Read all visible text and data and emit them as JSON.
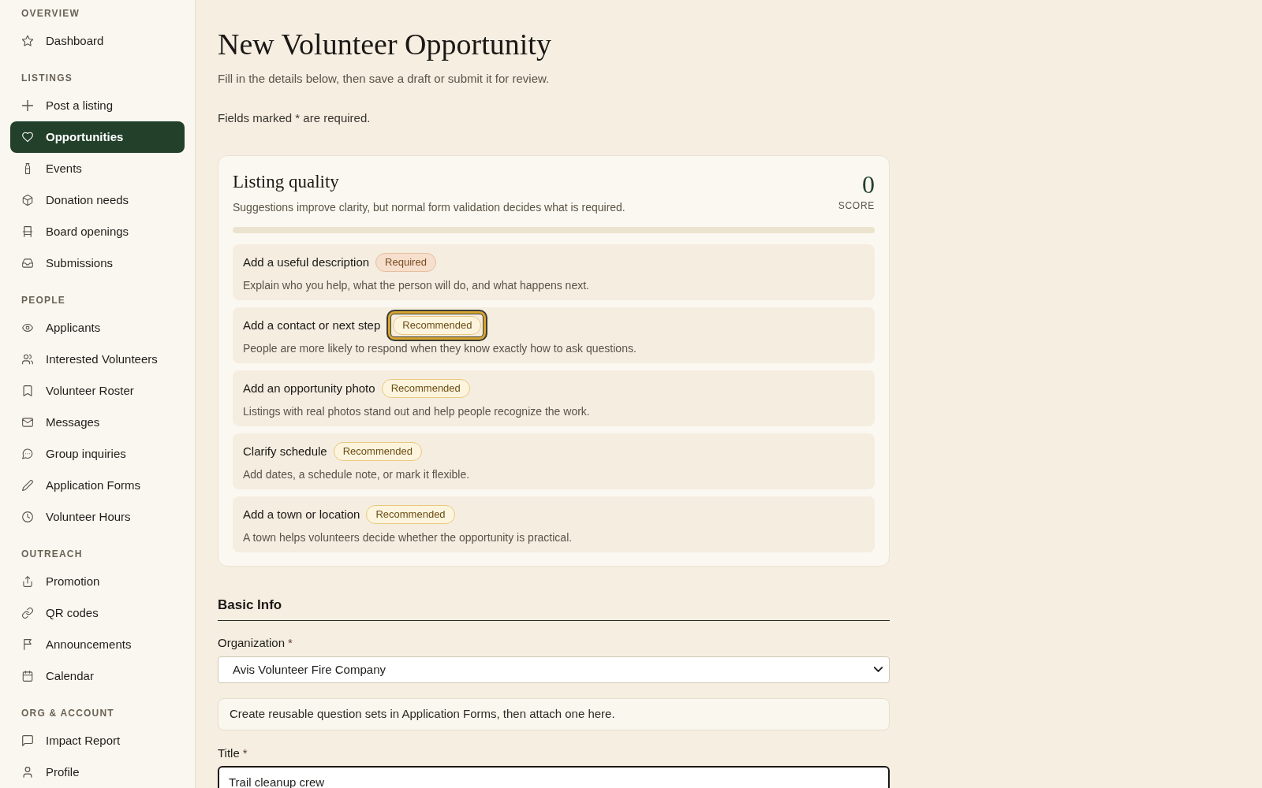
{
  "sidebar": {
    "sections": [
      {
        "heading": "OVERVIEW",
        "items": [
          {
            "label": "Dashboard",
            "selected": false
          }
        ]
      },
      {
        "heading": "LISTINGS",
        "items": [
          {
            "label": "Post a listing",
            "selected": false
          },
          {
            "label": "Opportunities",
            "selected": true
          },
          {
            "label": "Events",
            "selected": false
          },
          {
            "label": "Donation needs",
            "selected": false
          },
          {
            "label": "Board openings",
            "selected": false
          },
          {
            "label": "Submissions",
            "selected": false
          }
        ]
      },
      {
        "heading": "PEOPLE",
        "items": [
          {
            "label": "Applicants",
            "selected": false
          },
          {
            "label": "Interested Volunteers",
            "selected": false
          },
          {
            "label": "Volunteer Roster",
            "selected": false
          },
          {
            "label": "Messages",
            "selected": false
          },
          {
            "label": "Group inquiries",
            "selected": false
          },
          {
            "label": "Application Forms",
            "selected": false
          },
          {
            "label": "Volunteer Hours",
            "selected": false
          }
        ]
      },
      {
        "heading": "OUTREACH",
        "items": [
          {
            "label": "Promotion",
            "selected": false
          },
          {
            "label": "QR codes",
            "selected": false
          },
          {
            "label": "Announcements",
            "selected": false
          },
          {
            "label": "Calendar",
            "selected": false
          }
        ]
      },
      {
        "heading": "ORG & ACCOUNT",
        "items": [
          {
            "label": "Impact Report",
            "selected": false
          },
          {
            "label": "Profile",
            "selected": false
          }
        ]
      }
    ]
  },
  "page": {
    "title": "New Volunteer Opportunity",
    "subtitle": "Fill in the details below, then save a draft or submit it for review.",
    "required_note": "Fields marked * are required."
  },
  "listing_quality": {
    "title": "Listing quality",
    "description": "Suggestions improve clarity, but normal form validation decides what is required.",
    "score": "0",
    "score_label": "SCORE",
    "level": 0,
    "suggestions": [
      {
        "title": "Add a useful description",
        "badge": "Required",
        "kind": "required",
        "focused": false,
        "description": "Explain who you help, what the person will do, and what happens next."
      },
      {
        "title": "Add a contact or next step",
        "badge": "Recommended",
        "kind": "recommended",
        "focused": true,
        "description": "People are more likely to respond when they know exactly how to ask questions."
      },
      {
        "title": "Add an opportunity photo",
        "badge": "Recommended",
        "kind": "recommended",
        "focused": false,
        "description": "Listings with real photos stand out and help people recognize the work."
      },
      {
        "title": "Clarify schedule",
        "badge": "Recommended",
        "kind": "recommended",
        "focused": false,
        "description": "Add dates, a schedule note, or mark it flexible."
      },
      {
        "title": "Add a town or location",
        "badge": "Recommended",
        "kind": "recommended",
        "focused": false,
        "description": "A town helps volunteers decide whether the opportunity is practical."
      }
    ]
  },
  "basic_info": {
    "heading": "Basic Info",
    "organization": {
      "label": "Organization",
      "required_mark": "*",
      "value": "Avis Volunteer Fire Company"
    },
    "hint": "Create reusable question sets in Application Forms, then attach one here.",
    "title_field": {
      "label": "Title",
      "required_mark": "*",
      "value": "Trail cleanup crew",
      "focused": true
    }
  }
}
